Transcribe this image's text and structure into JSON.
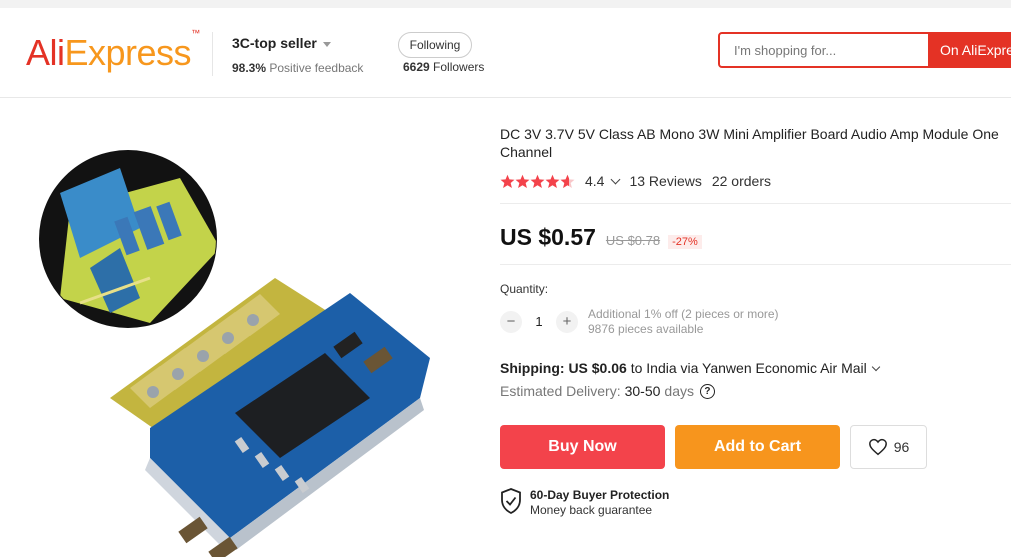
{
  "header": {
    "logo_part1": "Ali",
    "logo_part2": "Express",
    "logo_tm": "™",
    "seller_name": "3C-top seller",
    "feedback_percent": "98.3%",
    "feedback_label": "Positive feedback",
    "follow_button": "Following",
    "followers_count": "6629",
    "followers_label": "Followers",
    "search_placeholder": "I'm shopping for...",
    "search_button": "On AliExpress"
  },
  "product": {
    "title": "DC 3V 3.7V 5V Class AB Mono 3W Mini Amplifier Board Audio Amp Module One Channel",
    "rating": 4.4,
    "rating_text": "4.4",
    "reviews": "13 Reviews",
    "orders": "22 orders",
    "price": "US $0.57",
    "old_price": "US $0.78",
    "discount": "-27%",
    "image_subject": "chip-module-photo"
  },
  "quantity": {
    "label": "Quantity:",
    "minus": "−",
    "plus": "+",
    "value": "1",
    "note_discount": "Additional 1% off (2 pieces or more)",
    "note_available": "9876 pieces available"
  },
  "shipping": {
    "label": "Shipping:",
    "cost": "US $0.06",
    "destination": "to India via Yanwen Economic Air Mail",
    "delivery_label": "Estimated Delivery:",
    "delivery_value": "30-50",
    "delivery_unit": "days"
  },
  "actions": {
    "buy_now": "Buy Now",
    "add_to_cart": "Add to Cart",
    "wishlist_count": "96"
  },
  "protection": {
    "title": "60-Day Buyer Protection",
    "subtitle": "Money back guarantee"
  },
  "colors": {
    "brand_red": "#e43225",
    "brand_orange": "#f7971d",
    "buy_red": "#f3434b",
    "cart_orange": "#f7951d",
    "star": "#f3434b"
  }
}
